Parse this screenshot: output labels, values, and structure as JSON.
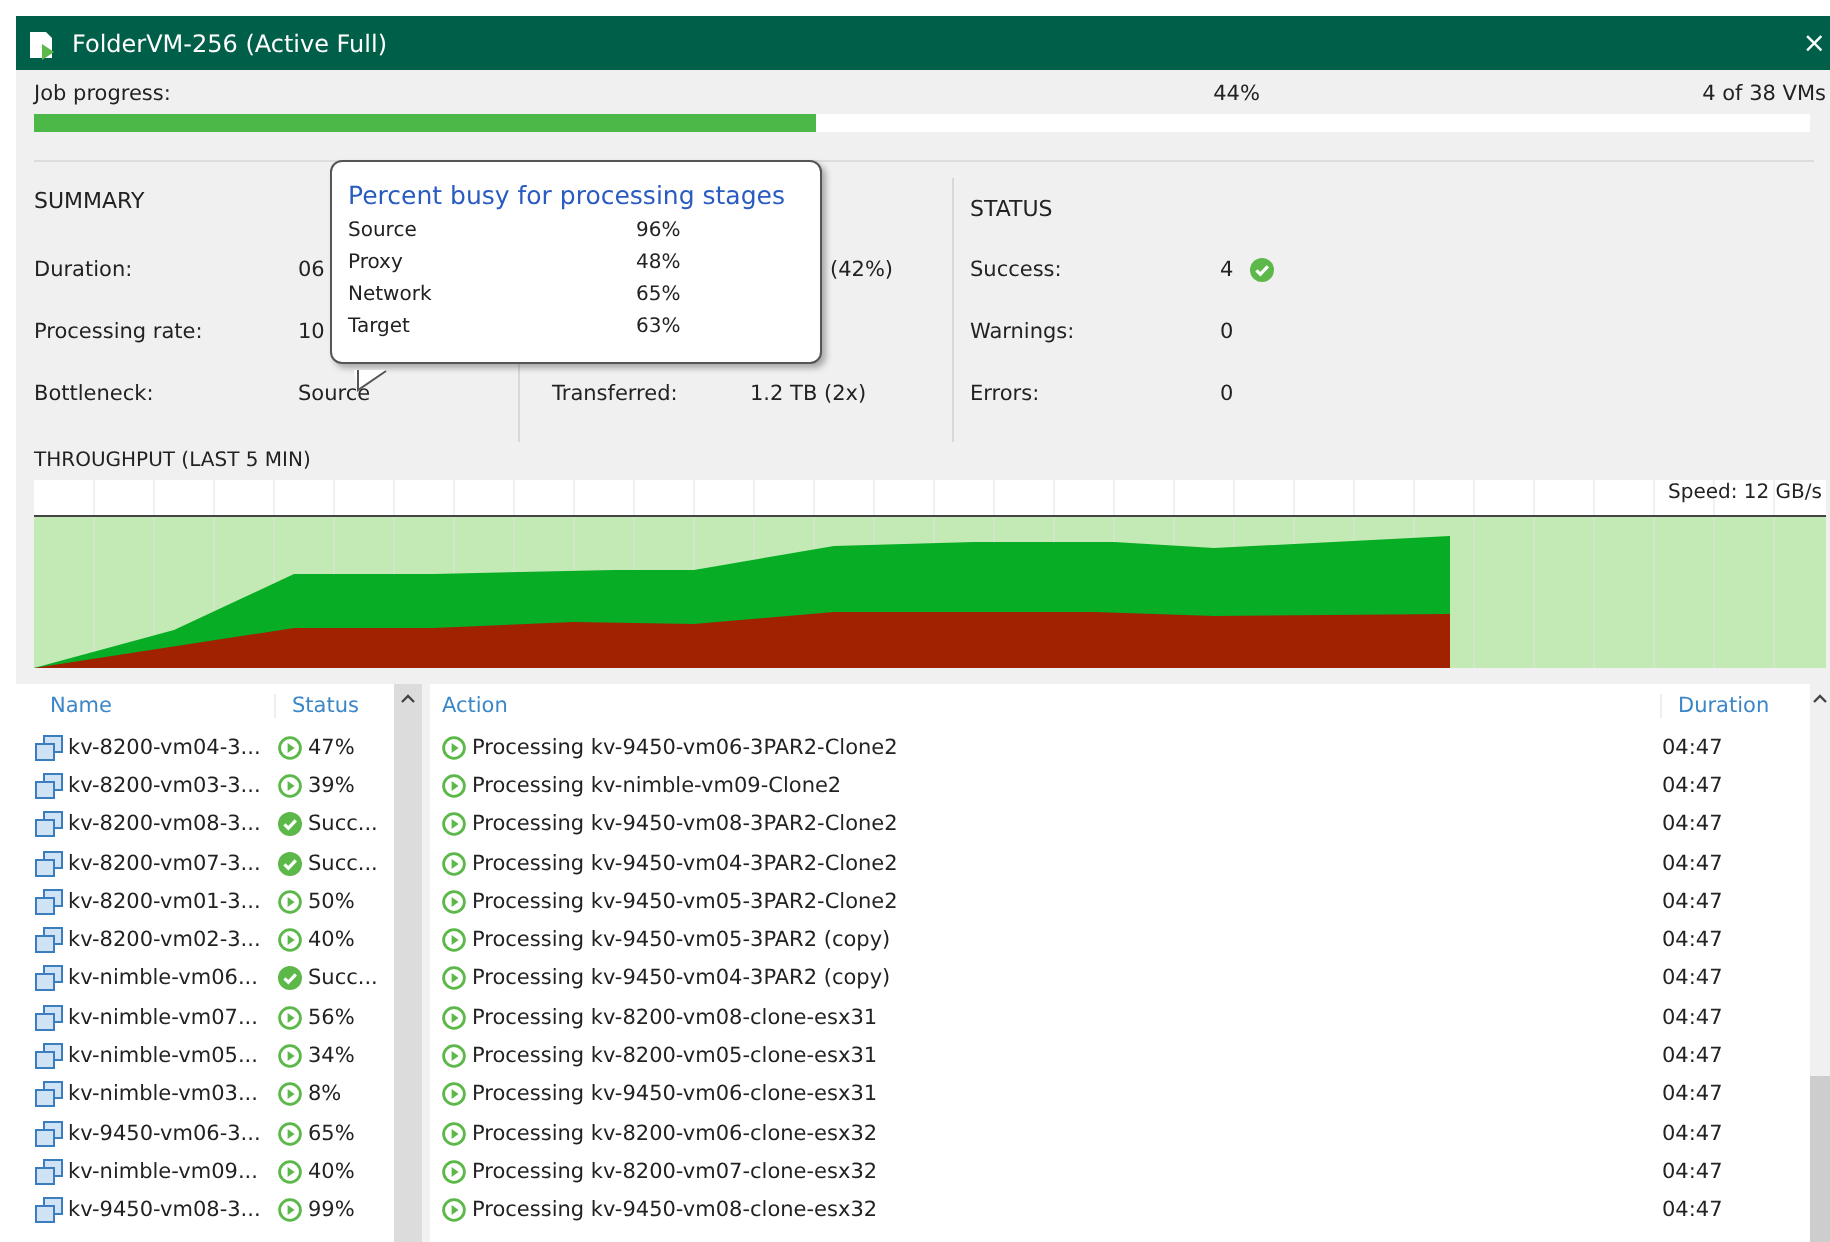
{
  "window": {
    "title": "FolderVM-256 (Active Full)",
    "close": "×"
  },
  "progress": {
    "label": "Job progress:",
    "percent": "44%",
    "count": "4 of 38 VMs",
    "level": 0.44
  },
  "summary": {
    "title": "SUMMARY",
    "items": [
      {
        "label": "Duration:",
        "value": "06"
      },
      {
        "label": "Processing rate:",
        "value": "10"
      },
      {
        "label": "Bottleneck:",
        "value": "Source"
      }
    ],
    "middle": [
      {
        "value": "(42%)"
      },
      {
        "label": "Transferred:",
        "value": "1.2 TB (2x)"
      }
    ]
  },
  "tooltip": {
    "title": "Percent busy for processing stages",
    "rows": [
      {
        "label": "Source",
        "value": "96%"
      },
      {
        "label": "Proxy",
        "value": "48%"
      },
      {
        "label": "Network",
        "value": "65%"
      },
      {
        "label": "Target",
        "value": "63%"
      }
    ]
  },
  "status": {
    "title": "STATUS",
    "items": [
      {
        "label": "Success:",
        "value": "4",
        "kind": "success"
      },
      {
        "label": "Warnings:",
        "value": "0",
        "kind": "plain"
      },
      {
        "label": "Errors:",
        "value": "0",
        "kind": "plain"
      }
    ]
  },
  "throughput": {
    "title": "THROUGHPUT (LAST 5 MIN)",
    "speed": "Speed: 12 GB/s"
  },
  "vm_table": {
    "columns": [
      "Name",
      "Status"
    ],
    "rows": [
      {
        "name": "kv-8200-vm04-3...",
        "status": "47%",
        "kind": "running"
      },
      {
        "name": "kv-8200-vm03-3...",
        "status": "39%",
        "kind": "running"
      },
      {
        "name": "kv-8200-vm08-3...",
        "status": "Succ...",
        "kind": "success"
      },
      {
        "name": "kv-8200-vm07-3...",
        "status": "Succ...",
        "kind": "success"
      },
      {
        "name": "kv-8200-vm01-3...",
        "status": "50%",
        "kind": "running"
      },
      {
        "name": "kv-8200-vm02-3...",
        "status": "40%",
        "kind": "running"
      },
      {
        "name": "kv-nimble-vm06...",
        "status": "Succ...",
        "kind": "success"
      },
      {
        "name": "kv-nimble-vm07...",
        "status": "56%",
        "kind": "running"
      },
      {
        "name": "kv-nimble-vm05...",
        "status": "34%",
        "kind": "running"
      },
      {
        "name": "kv-nimble-vm03...",
        "status": "8%",
        "kind": "running"
      },
      {
        "name": "kv-9450-vm06-3...",
        "status": "65%",
        "kind": "running"
      },
      {
        "name": "kv-nimble-vm09...",
        "status": "40%",
        "kind": "running"
      },
      {
        "name": "kv-9450-vm08-3...",
        "status": "99%",
        "kind": "running"
      }
    ]
  },
  "action_table": {
    "columns": [
      "Action",
      "Duration"
    ],
    "rows": [
      {
        "action": "Processing kv-9450-vm06-3PAR2-Clone2",
        "duration": "04:47"
      },
      {
        "action": "Processing kv-nimble-vm09-Clone2",
        "duration": "04:47"
      },
      {
        "action": "Processing kv-9450-vm08-3PAR2-Clone2",
        "duration": "04:47"
      },
      {
        "action": "Processing kv-9450-vm04-3PAR2-Clone2",
        "duration": "04:47"
      },
      {
        "action": "Processing kv-9450-vm05-3PAR2-Clone2",
        "duration": "04:47"
      },
      {
        "action": "Processing kv-9450-vm05-3PAR2 (copy)",
        "duration": "04:47"
      },
      {
        "action": "Processing kv-9450-vm04-3PAR2 (copy)",
        "duration": "04:47"
      },
      {
        "action": "Processing kv-8200-vm08-clone-esx31",
        "duration": "04:47"
      },
      {
        "action": "Processing kv-8200-vm05-clone-esx31",
        "duration": "04:47"
      },
      {
        "action": "Processing kv-9450-vm06-clone-esx31",
        "duration": "04:47"
      },
      {
        "action": "Processing kv-8200-vm06-clone-esx32",
        "duration": "04:47"
      },
      {
        "action": "Processing kv-8200-vm07-clone-esx32",
        "duration": "04:47"
      },
      {
        "action": "Processing kv-9450-vm08-clone-esx32",
        "duration": "04:47"
      }
    ]
  }
}
